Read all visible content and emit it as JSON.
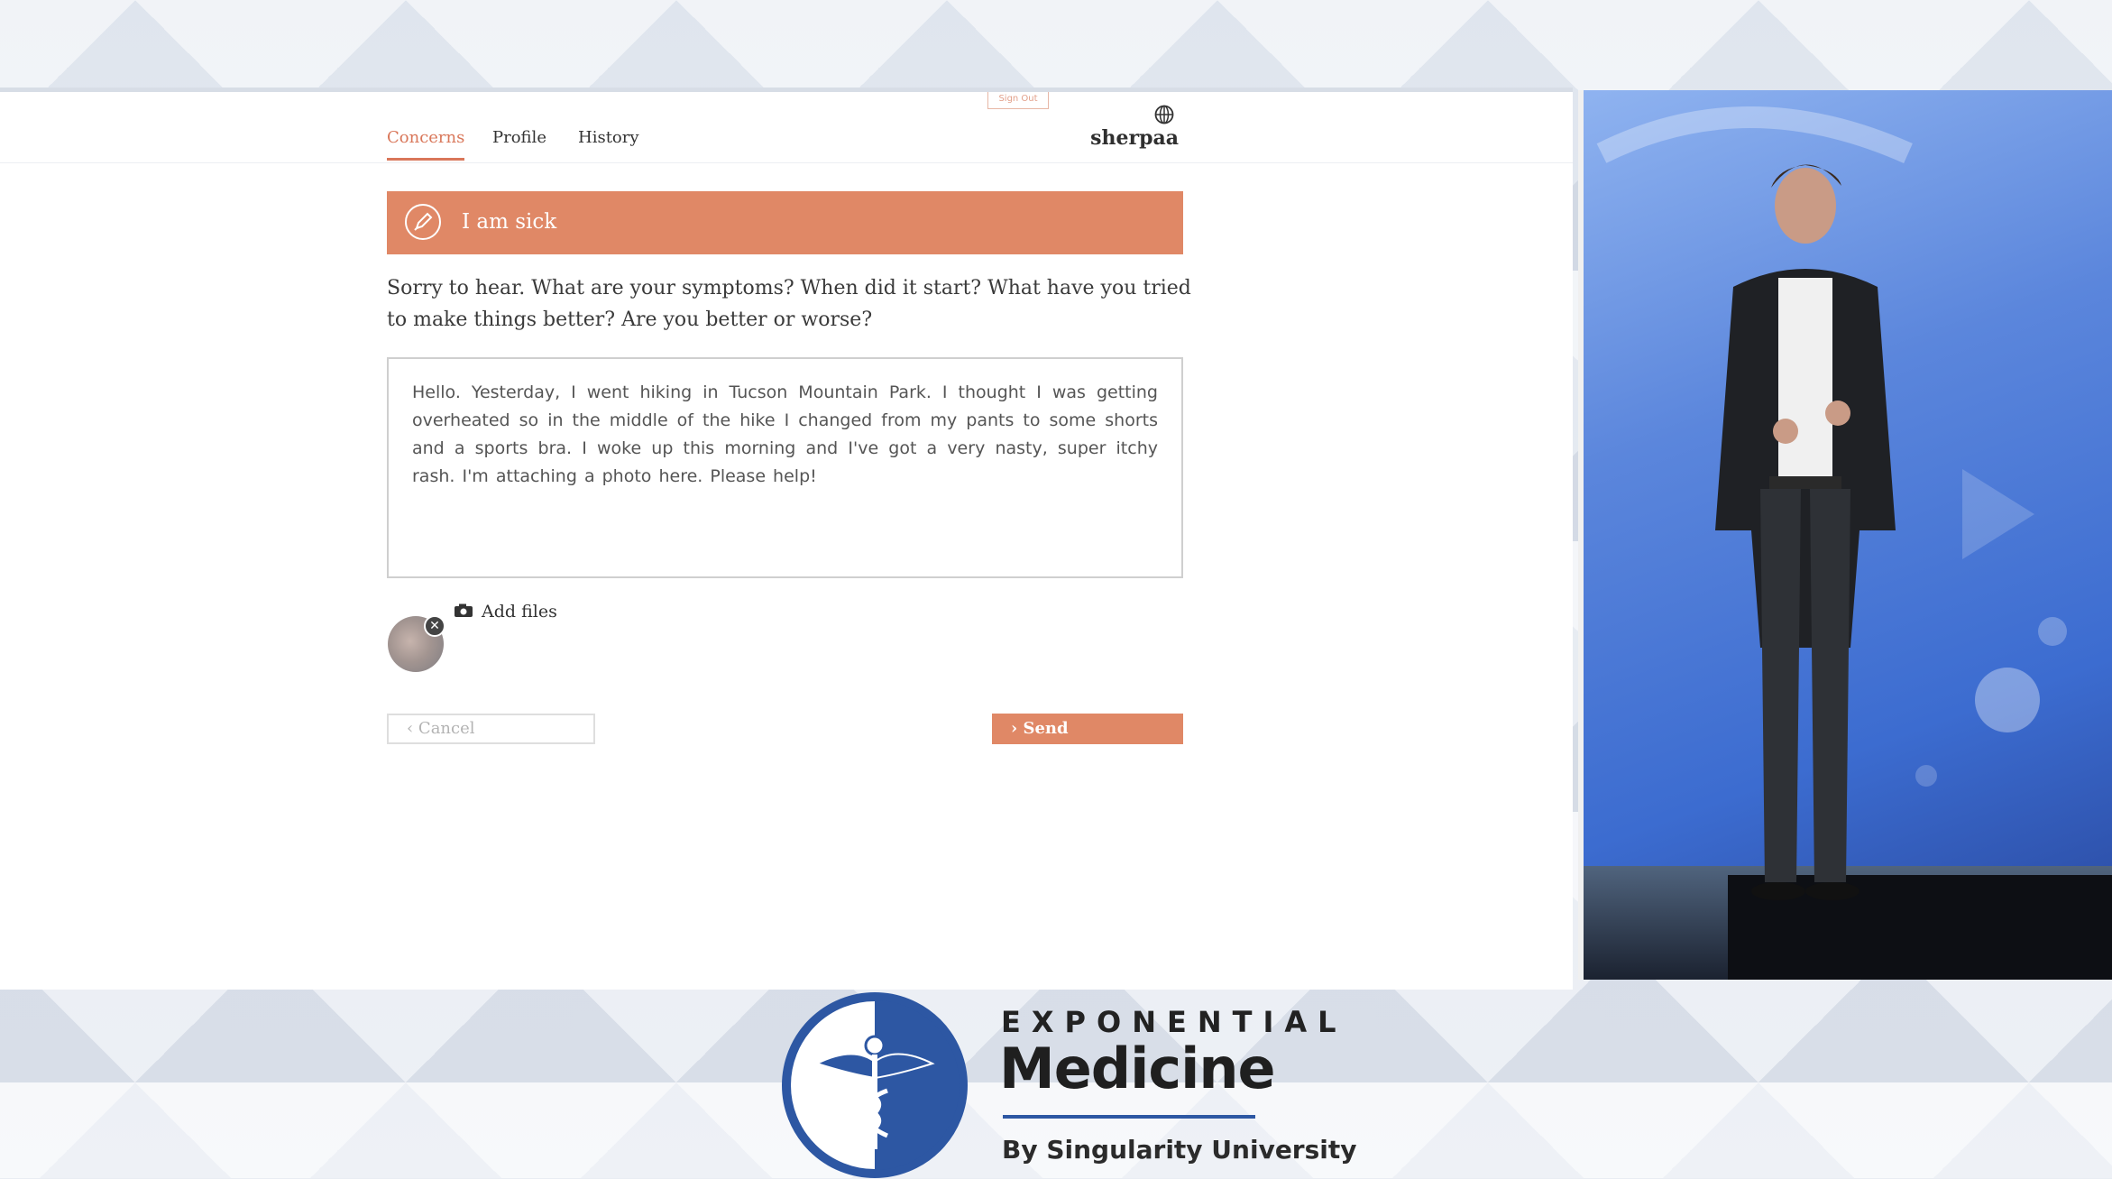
{
  "nav": {
    "tabs": [
      {
        "label": "Concerns",
        "active": true
      },
      {
        "label": "Profile",
        "active": false
      },
      {
        "label": "History",
        "active": false
      }
    ],
    "sign_out": "Sign Out",
    "logo": "sherpaa"
  },
  "banner": {
    "title": "I am sick",
    "icon": "pen-icon",
    "color": "#e08866"
  },
  "prompt": "Sorry to hear. What are your symptoms? When did it start? What have you tried to make things better? Are you better or worse?",
  "message": "Hello. Yesterday, I went hiking in Tucson Mountain Park. I thought I was getting overheated so in the middle of the hike I changed from my pants to some shorts and a sports bra. I woke up this morning and I've got a very nasty, super itchy rash. I'm attaching a photo here. Please help!",
  "attachments": {
    "add_label": "Add files",
    "icon": "camera-icon",
    "remove_glyph": "✕"
  },
  "actions": {
    "cancel": "‹ Cancel",
    "send": "› Send"
  },
  "branding": {
    "line1": "EXPONENTIAL",
    "line2": "Medicine",
    "line3": "By Singularity University",
    "accent": "#2d57a3"
  }
}
